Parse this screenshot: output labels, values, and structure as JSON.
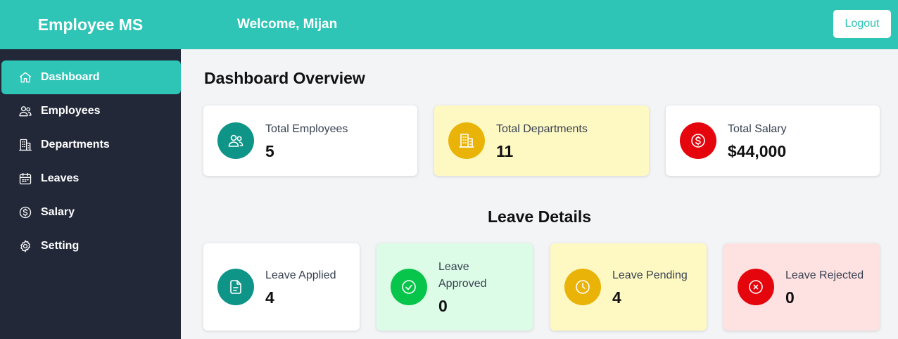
{
  "header": {
    "brand": "Employee MS",
    "welcome": "Welcome, Mijan",
    "logout_label": "Logout",
    "color": "#2ec4b6"
  },
  "sidebar": {
    "items": [
      {
        "label": "Dashboard",
        "icon": "home-icon",
        "active": true
      },
      {
        "label": "Employees",
        "icon": "users-icon"
      },
      {
        "label": "Departments",
        "icon": "building-icon"
      },
      {
        "label": "Leaves",
        "icon": "calendar-icon"
      },
      {
        "label": "Salary",
        "icon": "dollar-circle-icon"
      },
      {
        "label": "Setting",
        "icon": "gear-icon"
      }
    ]
  },
  "overview": {
    "title": "Dashboard Overview",
    "cards": [
      {
        "label": "Total Employees",
        "value": "5",
        "icon": "users-icon",
        "icon_color": "#0f9488",
        "bg": "#ffffff"
      },
      {
        "label": "Total Departments",
        "value": "11",
        "icon": "building-icon",
        "icon_color": "#eab308",
        "bg": "#fef9c3"
      },
      {
        "label": "Total Salary",
        "value": "$44,000",
        "icon": "dollar-circle-icon",
        "icon_color": "#e5050d",
        "bg": "#ffffff"
      }
    ]
  },
  "leave": {
    "title": "Leave Details",
    "cards": [
      {
        "label": "Leave Applied",
        "value": "4",
        "icon": "file-icon",
        "icon_color": "#0f9488",
        "bg": "#ffffff"
      },
      {
        "label": "Leave Approved",
        "value": "0",
        "icon": "check-circle-icon",
        "icon_color": "#06c54a",
        "bg": "#dcfce7"
      },
      {
        "label": "Leave Pending",
        "value": "4",
        "icon": "clock-icon",
        "icon_color": "#eab308",
        "bg": "#fef9c3"
      },
      {
        "label": "Leave Rejected",
        "value": "0",
        "icon": "x-circle-icon",
        "icon_color": "#e5050d",
        "bg": "#fee2e2"
      }
    ]
  }
}
